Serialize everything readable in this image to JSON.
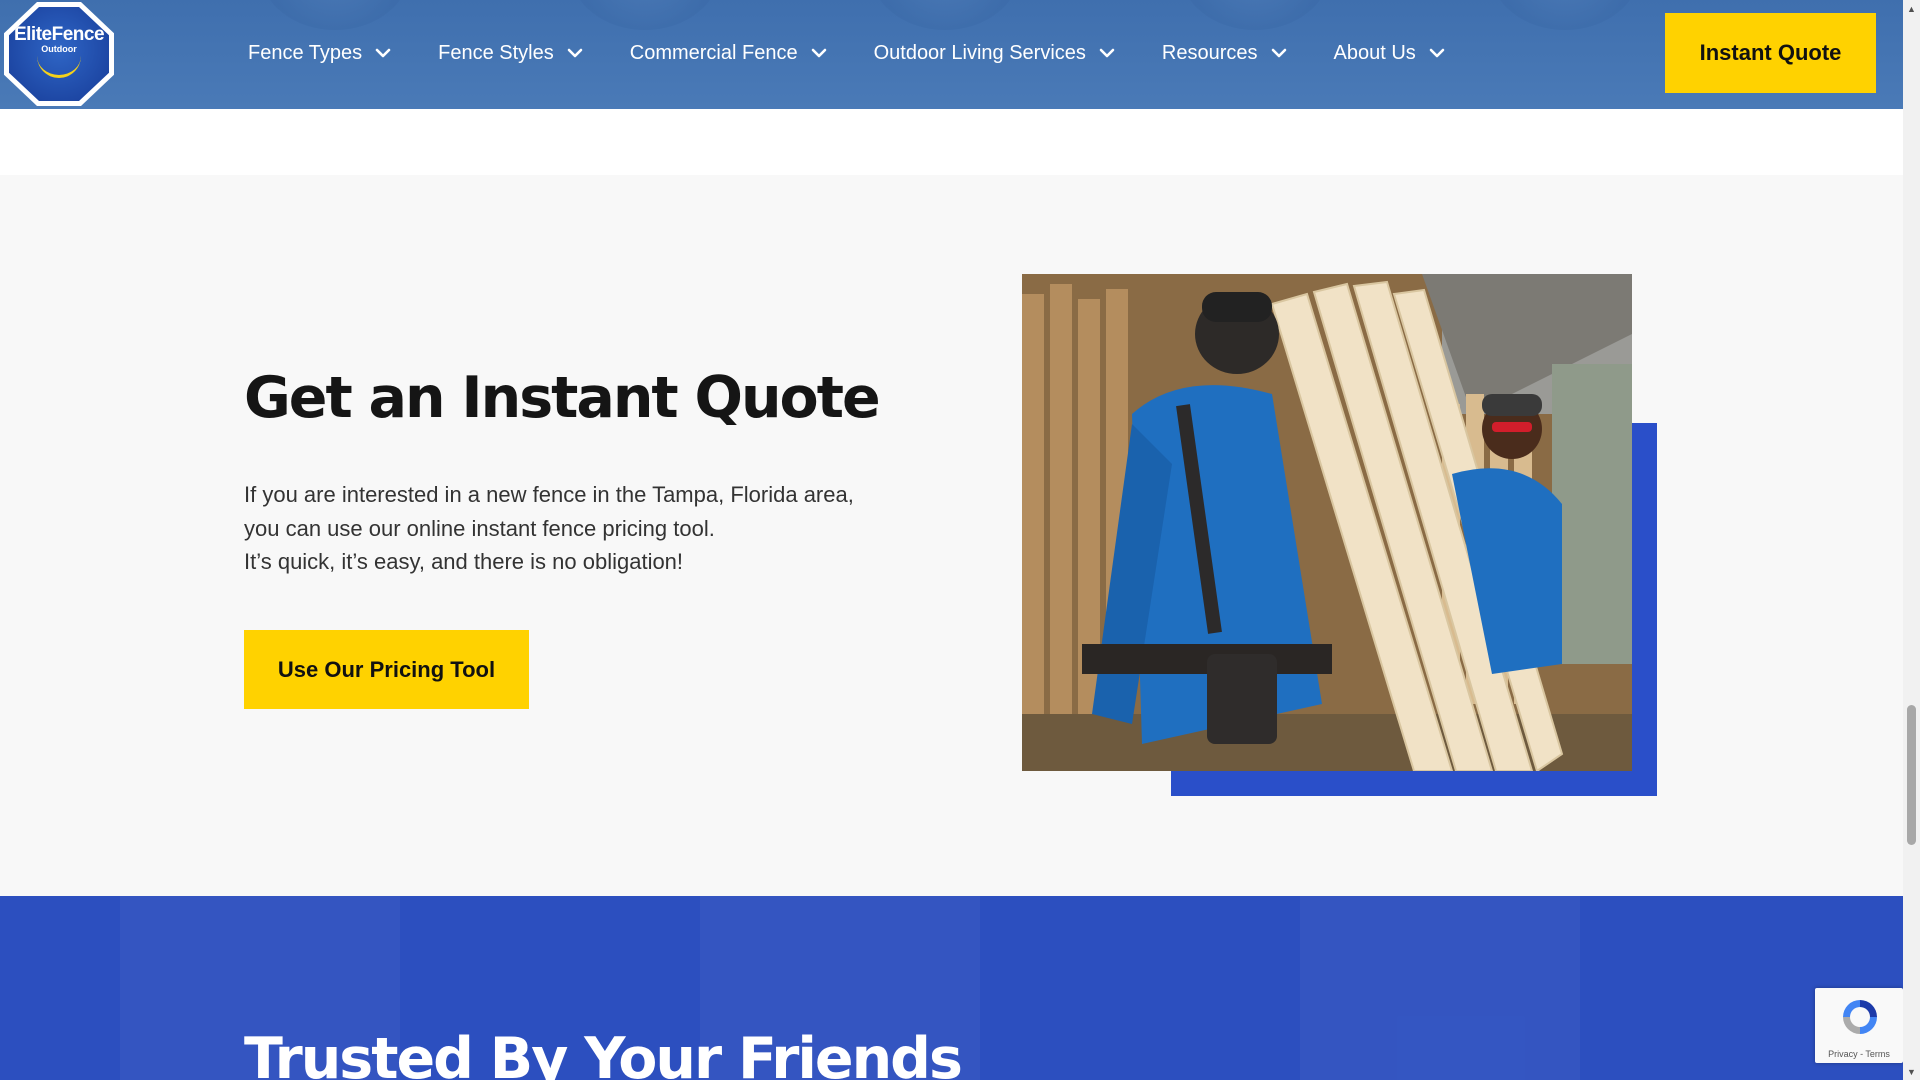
{
  "header": {
    "logo": {
      "brand": "EliteFence",
      "sub": "Outdoor"
    },
    "nav": [
      {
        "label": "Fence Types",
        "icon": "chevron-down-icon"
      },
      {
        "label": "Fence Styles",
        "icon": "chevron-down-icon"
      },
      {
        "label": "Commercial Fence",
        "icon": "chevron-down-icon"
      },
      {
        "label": "Outdoor Living Services",
        "icon": "chevron-down-icon"
      },
      {
        "label": "Resources",
        "icon": "chevron-down-icon"
      },
      {
        "label": "About Us",
        "icon": "chevron-down-icon"
      }
    ],
    "cta_label": "Instant Quote"
  },
  "quote_section": {
    "title": "Get an Instant Quote",
    "body_lines": [
      "If you are interested in a new fence in the Tampa, Florida area,",
      "you can use our online instant fence pricing tool.",
      "It’s quick, it’s easy, and there is no obligation!"
    ],
    "button_label": "Use Our Pricing Tool",
    "image_icon": "photo-fence-installers"
  },
  "trust_section": {
    "title": "Trusted By Your Friends"
  },
  "recaptcha": {
    "text": "Privacy - Terms",
    "icon": "recaptcha-icon"
  },
  "colors": {
    "header_blue": "#4574b2",
    "accent_yellow": "#ffd200",
    "brand_blue": "#2c4fbf",
    "section_gray": "#f8f8f8"
  }
}
